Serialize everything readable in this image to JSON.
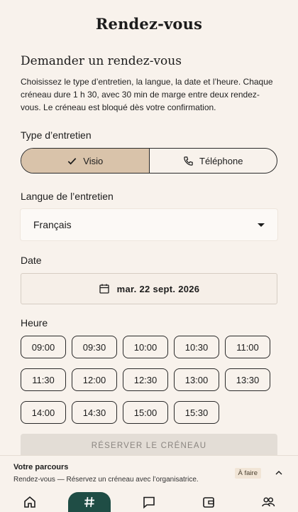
{
  "app": {
    "title": "Rendez-vous"
  },
  "section": {
    "title": "Demander un rendez-vous",
    "intro": "Choisissez le type d’entretien, la langue, la date et l’heure. Chaque créneau dure 1 h 30, avec 30 min de marge entre deux rendez-vous. Le créneau est bloqué dès votre confirmation."
  },
  "interview_type": {
    "label": "Type d’entretien",
    "options": [
      {
        "label": "Visio",
        "icon": "check-icon",
        "selected": true
      },
      {
        "label": "Téléphone",
        "icon": "phone-icon",
        "selected": false
      }
    ]
  },
  "language": {
    "label": "Langue de l’entretien",
    "value": "Français"
  },
  "date": {
    "label": "Date",
    "value": "mar. 22 sept. 2026",
    "icon": "calendar-icon"
  },
  "time": {
    "label": "Heure",
    "slots": [
      "09:00",
      "09:30",
      "10:00",
      "10:30",
      "11:00",
      "11:30",
      "12:00",
      "12:30",
      "13:00",
      "13:30",
      "14:00",
      "14:30",
      "15:00",
      "15:30"
    ]
  },
  "reserve_button": "RÉSERVER LE CRÉNEAU",
  "parcours": {
    "title": "Votre parcours",
    "text": "Rendez-vous — Réservez un créneau avec l’organisatrice.",
    "badge": "À faire"
  },
  "nav": [
    "home-icon",
    "hash-icon",
    "chat-icon",
    "wallet-icon",
    "people-icon"
  ],
  "colors": {
    "background": "#f8f2ec",
    "selected": "#d9c3aa",
    "nav_active": "#1f4d45"
  }
}
